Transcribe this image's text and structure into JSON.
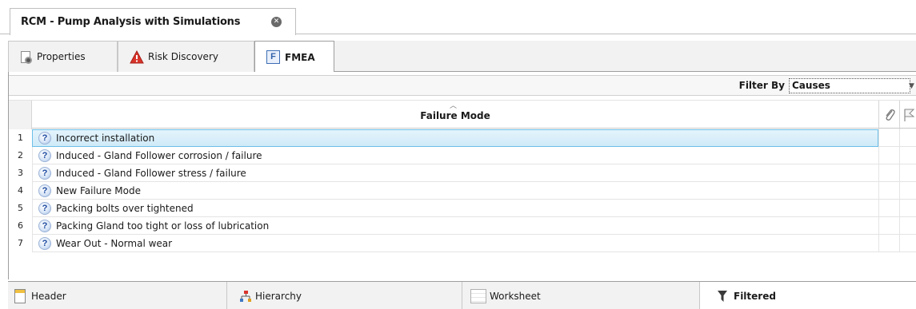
{
  "doc_tab": {
    "title": "RCM - Pump Analysis with Simulations"
  },
  "subtabs": [
    {
      "label": "Properties",
      "icon": "properties-icon"
    },
    {
      "label": "Risk Discovery",
      "icon": "warning-icon"
    },
    {
      "label": "FMEA",
      "icon": "fmea-icon",
      "active": true
    }
  ],
  "filter": {
    "label": "Filter By",
    "value": "Causes"
  },
  "grid": {
    "column_header": "Failure Mode",
    "rows": [
      {
        "num": "1",
        "text": "Incorrect installation",
        "selected": true
      },
      {
        "num": "2",
        "text": "Induced - Gland Follower corrosion / failure"
      },
      {
        "num": "3",
        "text": "Induced - Gland Follower stress / failure"
      },
      {
        "num": "4",
        "text": "New Failure Mode"
      },
      {
        "num": "5",
        "text": "Packing bolts over tightened"
      },
      {
        "num": "6",
        "text": "Packing Gland too tight or loss of lubrication"
      },
      {
        "num": "7",
        "text": "Wear Out - Normal wear"
      }
    ]
  },
  "bottom_tabs": [
    {
      "label": "Header",
      "icon": "header-icon"
    },
    {
      "label": "Hierarchy",
      "icon": "hierarchy-icon"
    },
    {
      "label": "Worksheet",
      "icon": "worksheet-icon"
    },
    {
      "label": "Filtered",
      "icon": "filter-icon",
      "active": true
    }
  ],
  "colors": {
    "selection_border": "#6cbfe8",
    "selection_fill": "#d9eff9",
    "warning": "#d9342b"
  }
}
